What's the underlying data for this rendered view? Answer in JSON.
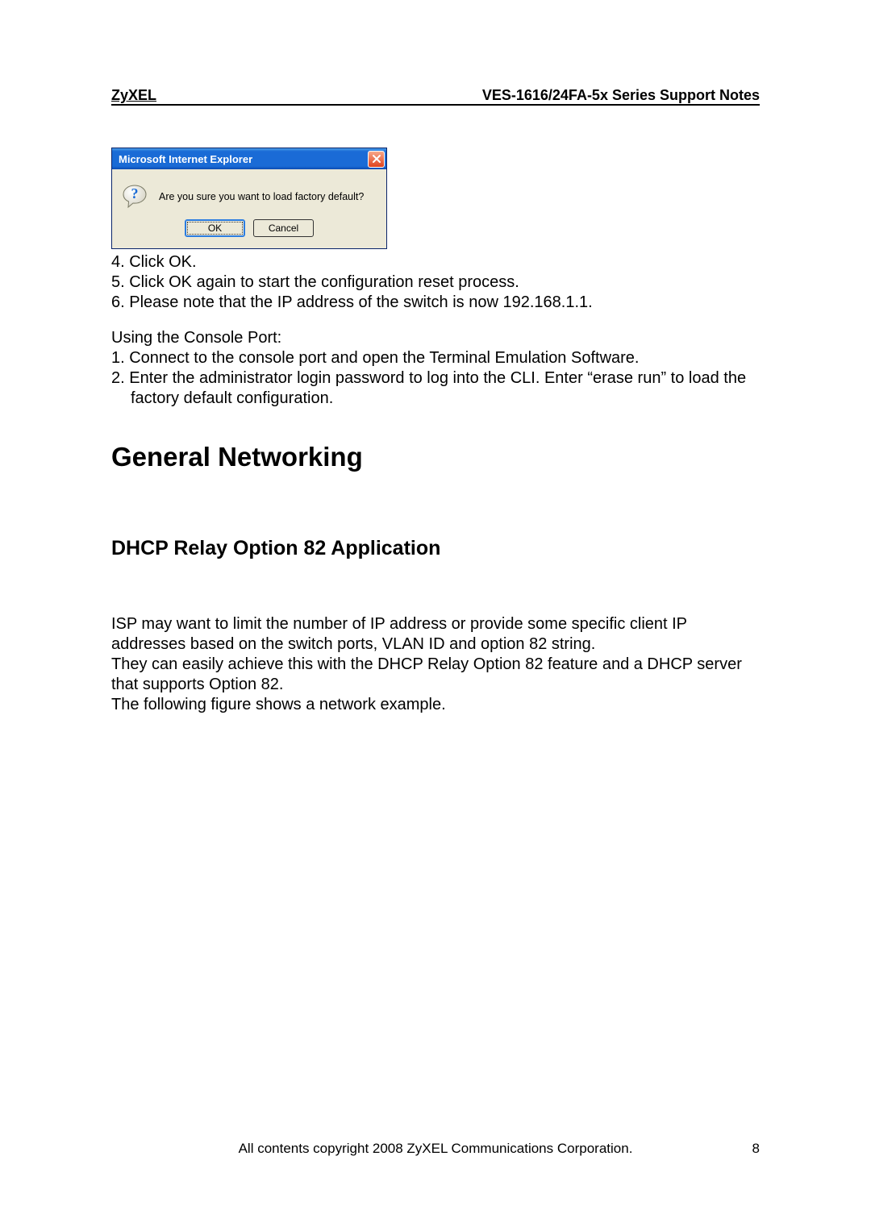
{
  "header": {
    "brand": "ZyXEL",
    "doc_title": "VES-1616/24FA-5x Series Support Notes"
  },
  "dialog": {
    "title": "Microsoft Internet Explorer",
    "message": "Are you sure you want to load factory default?",
    "ok_label": "OK",
    "cancel_label": "Cancel"
  },
  "steps_a": {
    "s4": "4. Click OK.",
    "s5": "5. Click OK again to start the configuration reset process.",
    "s6": "6. Please note that the IP address of the switch is now 192.168.1.1."
  },
  "console_heading": "Using the Console Port:",
  "steps_b": {
    "s1": "1. Connect to the console port and open the Terminal Emulation Software.",
    "s2": "2. Enter the administrator login password to log into the CLI. Enter “erase run” to load the factory default configuration."
  },
  "h1": "General Networking",
  "h2": "DHCP Relay Option 82 Application",
  "body": {
    "p1": "ISP may want to limit the number of IP address or provide some specific client IP addresses based on the switch ports, VLAN ID and option 82 string.",
    "p2": "They can easily achieve this with the DHCP Relay Option 82 feature and a DHCP server that supports Option 82.",
    "p3": "The following figure shows a network example."
  },
  "footer": {
    "copyright": "All contents copyright 2008 ZyXEL Communications Corporation.",
    "page_number": "8"
  }
}
